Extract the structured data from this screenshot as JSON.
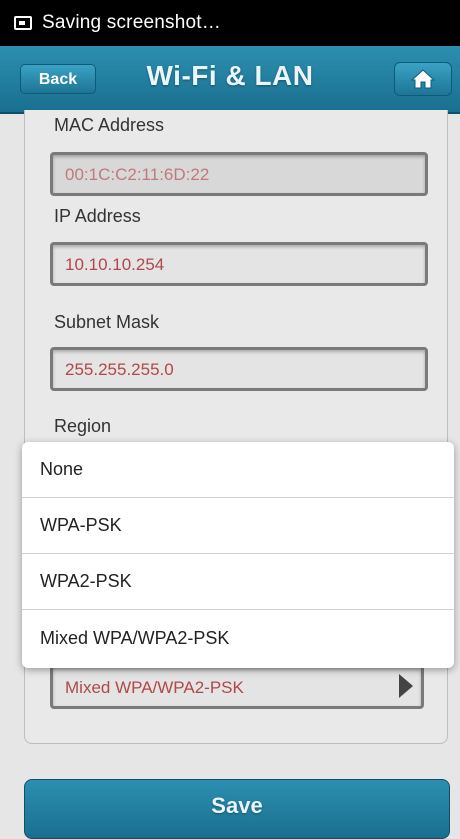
{
  "status_bar": {
    "text": "Saving screenshot…"
  },
  "header": {
    "back_label": "Back",
    "title": "Wi-Fi & LAN"
  },
  "fields": {
    "mac": {
      "label": "MAC Address",
      "value": "00:1C:C2:11:6D:22"
    },
    "ip": {
      "label": "IP Address",
      "value": "10.10.10.254"
    },
    "subnet": {
      "label": "Subnet Mask",
      "value": "255.255.255.0"
    },
    "region": {
      "label": "Region"
    },
    "security": {
      "value": "Mixed WPA/WPA2-PSK"
    }
  },
  "popup": {
    "options": [
      "None",
      "WPA-PSK",
      "WPA2-PSK",
      "Mixed WPA/WPA2-PSK"
    ]
  },
  "footer": {
    "save_label": "Save"
  },
  "colors": {
    "header": "#1d7ea0",
    "value_text": "#b04848"
  }
}
